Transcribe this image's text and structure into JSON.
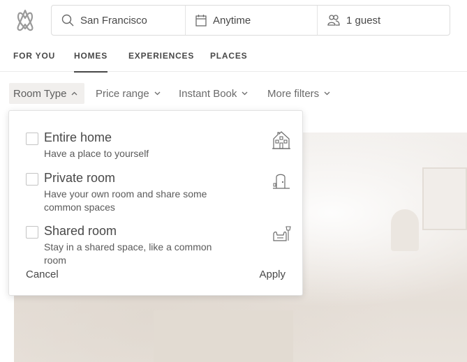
{
  "search": {
    "location": "San Francisco",
    "dates": "Anytime",
    "guests": "1 guest"
  },
  "tabs": [
    {
      "label": "FOR YOU",
      "active": false
    },
    {
      "label": "HOMES",
      "active": true
    },
    {
      "label": "EXPERIENCES",
      "active": false
    },
    {
      "label": "PLACES",
      "active": false
    }
  ],
  "filters": {
    "room_type": "Room Type",
    "price_range": "Price range",
    "instant_book": "Instant Book",
    "more_filters": "More filters"
  },
  "room_type_panel": {
    "options": [
      {
        "title": "Entire home",
        "description": "Have a place to yourself",
        "icon": "house-icon",
        "checked": false
      },
      {
        "title": "Private room",
        "description": "Have your own room and share some common spaces",
        "icon": "door-icon",
        "checked": false
      },
      {
        "title": "Shared room",
        "description": "Stay in a shared space, like a common room",
        "icon": "armchair-lamp-icon",
        "checked": false
      }
    ],
    "cancel_label": "Cancel",
    "apply_label": "Apply"
  },
  "colors": {
    "text": "#484848",
    "muted": "#6a6a6a",
    "border": "#dcdcdc"
  }
}
